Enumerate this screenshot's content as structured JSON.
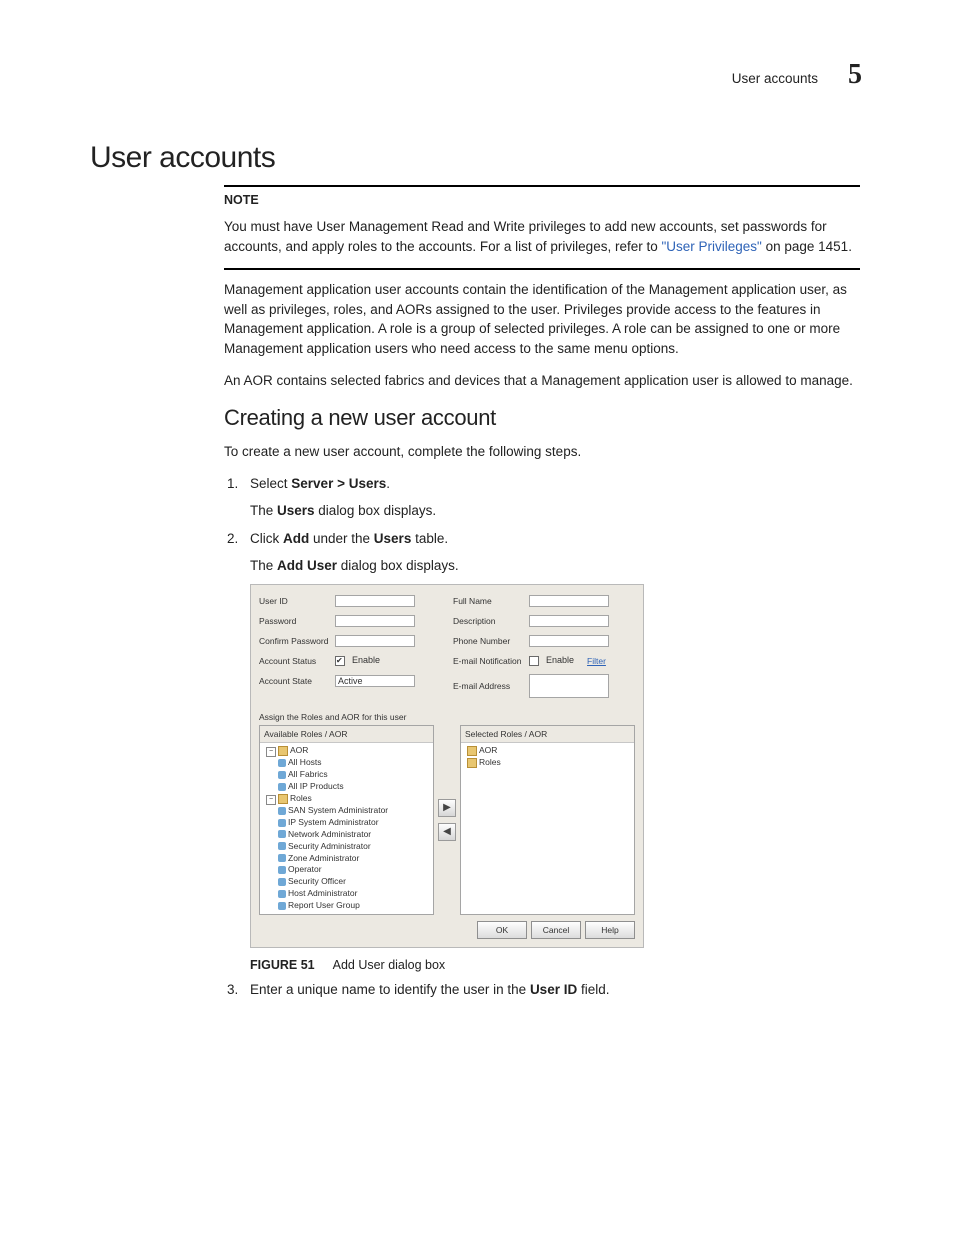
{
  "header": {
    "running_title": "User accounts",
    "chapter_number": "5"
  },
  "h1": "User accounts",
  "note": {
    "label": "NOTE",
    "text_before": "You must have User Management Read and Write privileges to add new accounts, set passwords for accounts, and apply roles to the accounts. For a list of privileges, refer to ",
    "link_text": "\"User Privileges\"",
    "text_after": " on page 1451."
  },
  "para1": "Management application user accounts contain the identification of the Management application user, as well as privileges, roles, and AORs assigned to the user. Privileges provide access to the features in Management application. A role is a group of selected privileges. A role can be assigned to one or more Management application users who need access to the same menu options.",
  "para2": "An AOR contains selected fabrics and devices that a Management application user is allowed to manage.",
  "h2": "Creating a new user account",
  "intro2": "To create a new user account, complete the following steps.",
  "steps": {
    "s1": {
      "before": "Select ",
      "bold": "Server > Users",
      "after": ".",
      "sub_before": "The ",
      "sub_bold": "Users",
      "sub_after": " dialog box displays."
    },
    "s2": {
      "before": "Click ",
      "bold1": "Add",
      "mid": " under the ",
      "bold2": "Users",
      "after": " table.",
      "sub_before": "The ",
      "sub_bold": "Add User",
      "sub_after": " dialog box displays."
    },
    "s3": {
      "before": "Enter a unique name to identify the user in the ",
      "bold": "User ID",
      "after": " field."
    }
  },
  "figure": {
    "label": "FIGURE 51",
    "caption": "Add User dialog box"
  },
  "dialog": {
    "left": {
      "user_id": "User ID",
      "password": "Password",
      "confirm_password": "Confirm Password",
      "account_status": "Account Status",
      "status_enable": "Enable",
      "account_state": "Account State",
      "state_value": "Active"
    },
    "right": {
      "full_name": "Full Name",
      "description": "Description",
      "phone_number": "Phone Number",
      "email_notif": "E-mail Notification",
      "notif_enable": "Enable",
      "notif_filter": "Filter",
      "email_addr": "E-mail Address"
    },
    "assign_label": "Assign the Roles and AOR for this user",
    "available_hdr": "Available Roles / AOR",
    "selected_hdr": "Selected Roles / AOR",
    "avail": {
      "aor": "AOR",
      "aor_items": [
        "All Hosts",
        "All Fabrics",
        "All IP Products"
      ],
      "roles": "Roles",
      "role_items": [
        "SAN System Administrator",
        "IP System Administrator",
        "Network Administrator",
        "Security Administrator",
        "Zone Administrator",
        "Operator",
        "Security Officer",
        "Host Administrator",
        "Report User Group"
      ]
    },
    "sel": {
      "aor": "AOR",
      "roles": "Roles"
    },
    "buttons": {
      "ok": "OK",
      "cancel": "Cancel",
      "help": "Help"
    }
  }
}
